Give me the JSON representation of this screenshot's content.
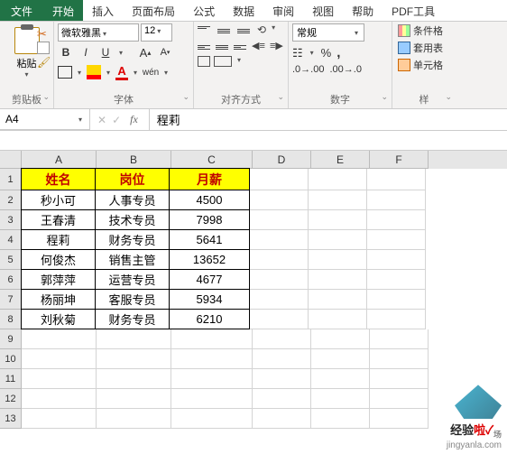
{
  "menu": {
    "file": "文件",
    "tabs": [
      "开始",
      "插入",
      "页面布局",
      "公式",
      "数据",
      "审阅",
      "视图",
      "帮助",
      "PDF工具"
    ],
    "active_index": 0
  },
  "ribbon": {
    "clipboard": {
      "paste": "粘贴",
      "label": "剪贴板"
    },
    "font": {
      "name": "微软雅黑",
      "size": "12",
      "wen": "wén",
      "label": "字体"
    },
    "alignment": {
      "label": "对齐方式"
    },
    "number": {
      "format": "常规",
      "label": "数字"
    },
    "styles": {
      "conditional": "条件格",
      "table": "套用表",
      "cell": "单元格",
      "label": "样"
    }
  },
  "namebox": "A4",
  "formula_value": "程莉",
  "columns": [
    "A",
    "B",
    "C",
    "D",
    "E",
    "F"
  ],
  "rows": [
    "1",
    "2",
    "3",
    "4",
    "5",
    "6",
    "7",
    "8",
    "9",
    "10",
    "11",
    "12",
    "13"
  ],
  "table": {
    "headers": [
      "姓名",
      "岗位",
      "月薪"
    ],
    "data": [
      [
        "秒小可",
        "人事专员",
        "4500"
      ],
      [
        "王春清",
        "技术专员",
        "7998"
      ],
      [
        "程莉",
        "财务专员",
        "5641"
      ],
      [
        "何俊杰",
        "销售主管",
        "13652"
      ],
      [
        "郭萍萍",
        "运营专员",
        "4677"
      ],
      [
        "杨丽坤",
        "客服专员",
        "5934"
      ],
      [
        "刘秋菊",
        "财务专员",
        "6210"
      ]
    ]
  },
  "watermark": {
    "text1": "经验",
    "text2": "啦",
    "check": "✓",
    "sub": "场",
    "url": "jingyanla.com"
  }
}
